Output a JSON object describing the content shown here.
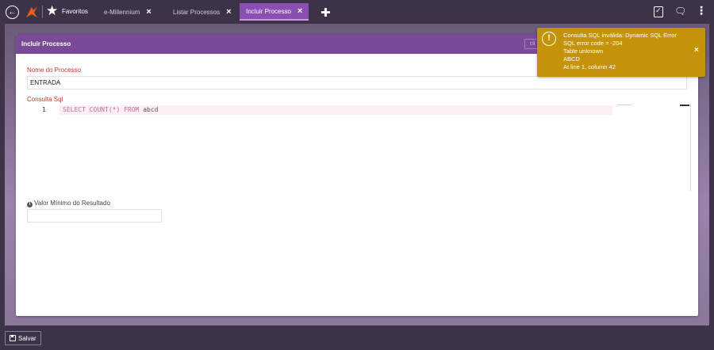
{
  "topbar": {
    "favorites_label": "Favoritos",
    "tabs": [
      {
        "label": "e-Millennium",
        "active": false
      },
      {
        "label": "Listar Processos",
        "active": false
      },
      {
        "label": "Incluir Processo",
        "active": true
      }
    ],
    "icons": [
      "back-icon",
      "logo-icon",
      "star-icon",
      "plus-icon",
      "clipboard-icon",
      "chat-icon",
      "kebab-icon"
    ]
  },
  "card": {
    "title": "Incluir Processo",
    "header_button_label": "cli",
    "fields": {
      "process_name_label": "Nome do Processo",
      "process_name_value": "ENTRADA",
      "sql_label": "Consulta Sql",
      "sql_line_number": "1",
      "sql_select": "SELECT",
      "sql_count": "COUNT(*)",
      "sql_from": "FROM",
      "sql_table": "abcd",
      "min_value_label": "Valor Mínimo do Resultado",
      "min_value_value": ""
    }
  },
  "toast": {
    "lines": [
      "Consulta SQL inválida: Dynamic SQL Error",
      "SQL error code = -204",
      "Table unknown",
      "ABCD",
      "At line 1, column 42"
    ],
    "icon": "exclamation-icon",
    "close": "×"
  },
  "footer": {
    "save_label": "Salvar"
  },
  "colors": {
    "topbar": "#3d3348",
    "card_header": "#7a4a99",
    "active_tab": "#8a4fb0",
    "toast": "#c4930a",
    "required_label": "#c0392b"
  }
}
